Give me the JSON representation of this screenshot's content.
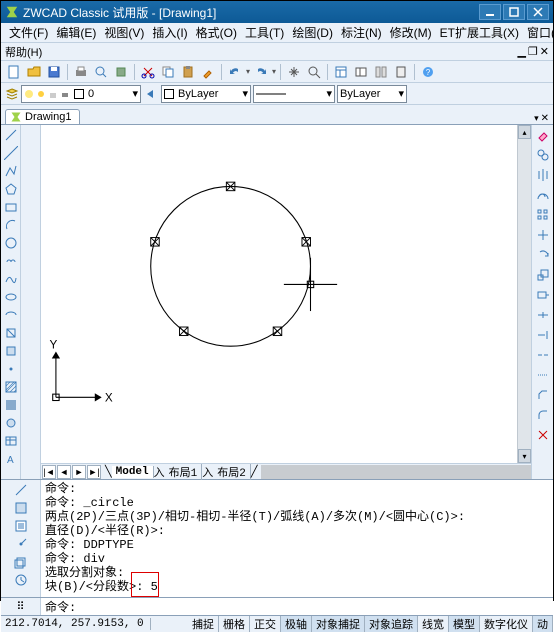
{
  "title": "ZWCAD Classic 试用版 - [Drawing1]",
  "menu": [
    "文件(F)",
    "编辑(E)",
    "视图(V)",
    "插入(I)",
    "格式(O)",
    "工具(T)",
    "绘图(D)",
    "标注(N)",
    "修改(M)",
    "ET扩展工具(X)",
    "窗口(W)"
  ],
  "menu2": "帮助(H)",
  "doc_tab": "Drawing1",
  "layer": {
    "name": "ByLayer",
    "line_label": "ByLayer"
  },
  "model_tabs": {
    "nav": [
      "|◄",
      "◄",
      "►",
      "►|"
    ],
    "model": "Model",
    "tabs": [
      "布局1",
      "布局2"
    ]
  },
  "cmd_history": [
    "命令:",
    "命令: _circle",
    "两点(2P)/三点(3P)/相切-相切-半径(T)/弧线(A)/多次(M)/<圆中心(C)>:",
    "直径(D)/<半径(R)>:",
    "命令: DDPTYPE",
    "命令: div",
    "选取分割对象:",
    "块(B)/<分段数>: 5"
  ],
  "cmd_prompt": "命令:",
  "status": {
    "coords": "212.7014, 257.9153, 0",
    "buttons": [
      "捕捉",
      "栅格",
      "正交",
      "极轴",
      "对象捕捉",
      "对象追踪",
      "线宽",
      "模型",
      "数字化仪",
      "动"
    ]
  },
  "ucs": {
    "x": "X",
    "y": "Y"
  }
}
